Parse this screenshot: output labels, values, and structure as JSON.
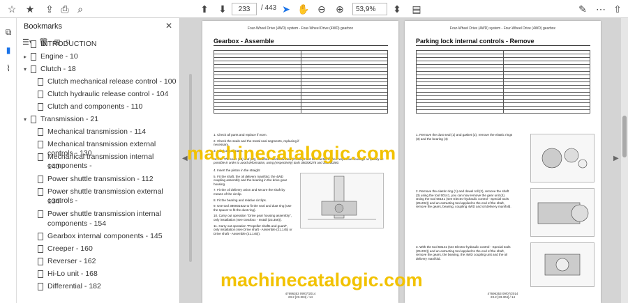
{
  "toolbar": {
    "page_current": "233",
    "page_total": "/ 443",
    "zoom": "53,9%"
  },
  "sidebar": {
    "title": "Bookmarks"
  },
  "bookmarks": [
    {
      "label": "INTRODUCTION"
    },
    {
      "label": "Engine - 10"
    },
    {
      "label": "Clutch - 18"
    },
    {
      "label": "Clutch mechanical release control - 100"
    },
    {
      "label": "Clutch hydraulic release control - 104"
    },
    {
      "label": "Clutch and components - 110"
    },
    {
      "label": "Transmission - 21"
    },
    {
      "label": "Mechanical transmission - 114"
    },
    {
      "label": "Mechanical transmission external controls - 130"
    },
    {
      "label": "Mechanical transmission internal components -"
    },
    {
      "label": "140"
    },
    {
      "label": "Power shuttle transmission - 112"
    },
    {
      "label": "Power shuttle transmission external controls -"
    },
    {
      "label": "134"
    },
    {
      "label": "Power shuttle transmission internal"
    },
    {
      "label": "components - 154"
    },
    {
      "label": "Gearbox internal components - 145"
    },
    {
      "label": "Creeper - 160"
    },
    {
      "label": "Reverser - 162"
    },
    {
      "label": "Hi-Lo unit - 168"
    },
    {
      "label": "Differential - 182"
    }
  ],
  "left_page": {
    "header": "Four-Wheel Drive (4WD) system - Four-Wheel Drive (4WD) gearbox",
    "title": "Gearbox - Assemble",
    "steps": [
      "1.   Check all parts and replace if worn.",
      "2.   Check the seals and the metal seal segments, replacing if necessary.",
      "3.   Lubricate all parts."
    ],
    "note": "NOTE: The seals (13) and (15), Gearbox - Sectional view (23.306) must be inserted in their respective housings as quickly as possible in order to avoid deformation, using (respectively) tools 380000278 and 380000280.",
    "steps2": [
      "4.   Insert the piston in the straight",
      "5.   Fit the shaft, the oil delivery manifold, the 4WD coupling assembly and the bearing in the drive gear housing.",
      "7.   Fit the oil delivery union and secure the shaft by means of the circlip.",
      "8.   Fit the bearing and relative circlips.",
      "9.   Use tool 380001622 to fit the seal and dust ring (use the spacer to fit the dust ring).",
      "10.  Carry out operation \"Drive gear housing assembly\", only installation (see Gearbox - Install (23.356)).",
      "11.  Carry out operation \"Propeller shafts and guard\", only installation (see Drive shaft - Assemble (21.145) or Drive shaft - Assemble (21.145))."
    ],
    "footer1": "47696353 09/07/2014",
    "footer2": "23.2 [23.304] / 14"
  },
  "right_page": {
    "header": "Four-Wheel Drive (4WD) system - Four-Wheel Drive (4WD) gearbox",
    "title": "Parking lock internal controls - Remove",
    "steps": [
      "1.   Remove the dust seal (1) and gasket (2), remove the elastic rings (3) and the bearing (4)",
      "2.   Remove the elastic ring (1) and dowel roll (2), remove the shaft (3) using the tool 50141, you can now remove the gear unit (4). Using the tool 50141 (see Electro-hydraulic control - Special tools (25.202)) and an extracting tool applied to the end of the shaft, remove the gears, bearing, coupling 4WD and oil delivery manifold.",
      "3.   With the tool 50141 (see Electro-hydraulic control - Special tools (25.202)) and an extracting tool applied to the end of the shaft, remove the gears, the bearing, the 4WD coupling unit and the oil delivery manifold."
    ],
    "footer1": "47696353 09/07/2014",
    "footer2": "23.2 [23.304] / 14"
  },
  "watermark": "machinecatalogic.com",
  "colors": {
    "watermark": "#f2c200",
    "accent": "#1a73e8"
  }
}
